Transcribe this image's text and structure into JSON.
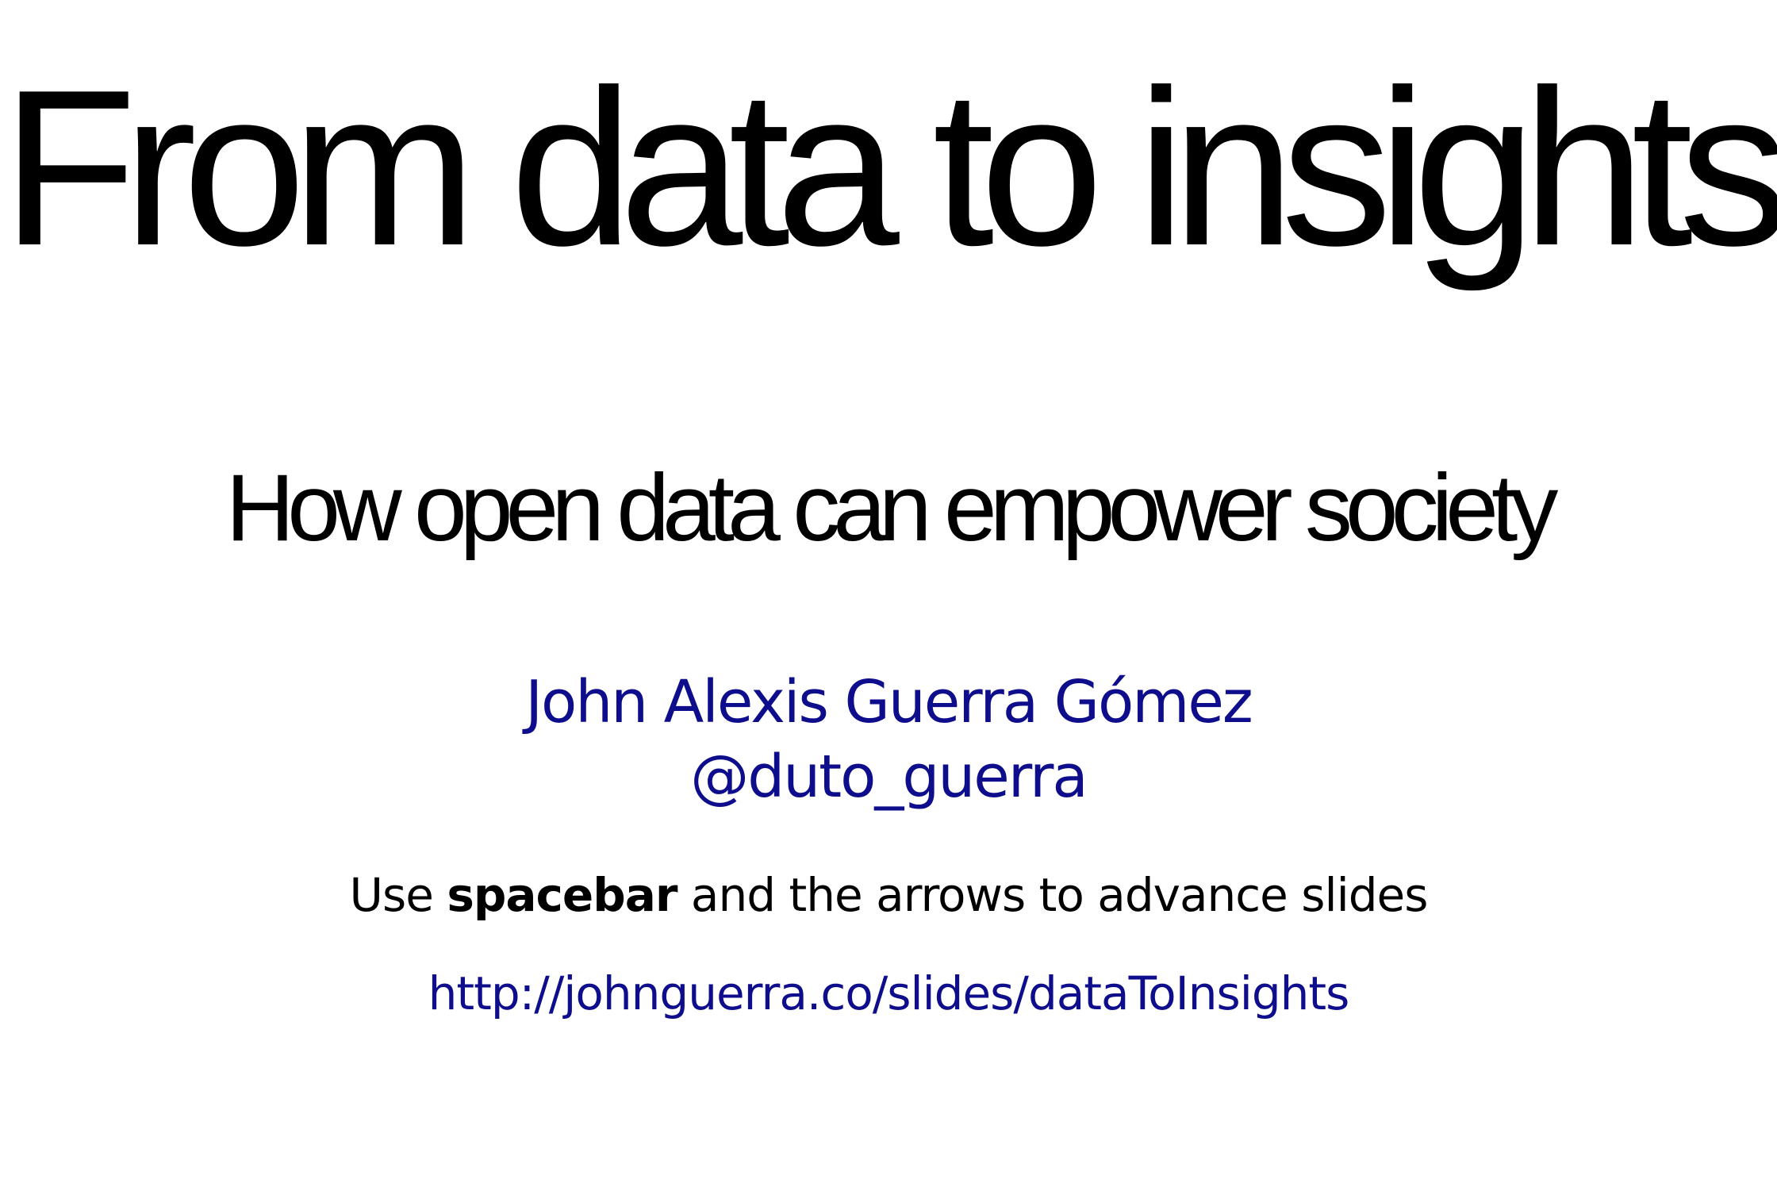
{
  "slide": {
    "title": "From data to insights",
    "subtitle": "How open data can empower society",
    "author": {
      "name": "John Alexis Guerra Gómez",
      "handle": "@duto_guerra"
    },
    "instructions": {
      "prefix": "Use ",
      "key": "spacebar",
      "suffix": " and the arrows to advance slides"
    },
    "link": {
      "text": "http://johnguerra.co/slides/dataToInsights",
      "href": "http://johnguerra.co/slides/dataToInsights"
    }
  },
  "colors": {
    "background": "#ffffff",
    "title": "#000000",
    "accent_link": "#0e0e8c"
  }
}
